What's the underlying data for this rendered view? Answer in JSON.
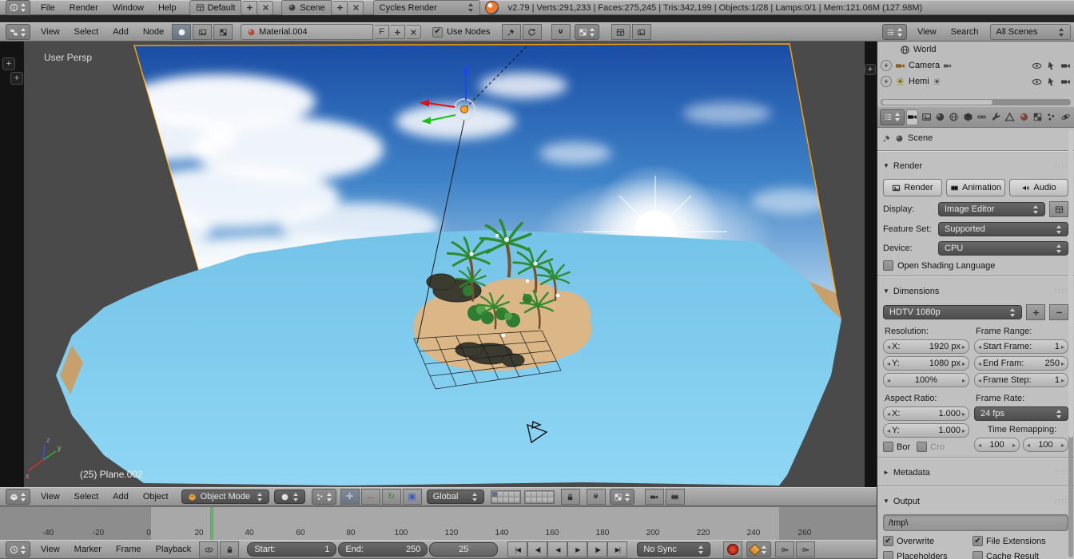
{
  "colors": {
    "selection_outline": "#ffa000",
    "cursor_green": "#55c155",
    "water": "#7cc9ec",
    "lamp_dot": "#ffa028",
    "record_red": "#b42010",
    "accent_sky": "#1a4da5"
  },
  "topbar": {
    "menus": [
      "File",
      "Render",
      "Window",
      "Help"
    ],
    "layout": "Default",
    "scene": "Scene",
    "engine": "Cycles Render",
    "stats": "v2.79 | Verts:291,233 | Faces:275,245 | Tris:342,199 | Objects:1/28 | Lamps:0/1 | Mem:121.06M (127.98M)"
  },
  "nodebar": {
    "menus": [
      "View",
      "Select",
      "Add",
      "Node"
    ],
    "material": "Material.004",
    "fake_user": "F",
    "use_nodes": "Use Nodes"
  },
  "outliner": {
    "menus": [
      "View",
      "Search"
    ],
    "filter": "All Scenes",
    "items": [
      "World",
      "Camera",
      "Hemi"
    ]
  },
  "viewport": {
    "view_label": "User Persp",
    "active_object": "(25) Plane.002",
    "axis": {
      "x": "x",
      "y": "y",
      "z": "z"
    }
  },
  "props": {
    "context": "Scene",
    "render": {
      "title": "Render",
      "buttons": {
        "render": "Render",
        "animation": "Animation",
        "audio": "Audio"
      },
      "display_label": "Display:",
      "display": "Image Editor",
      "feature_label": "Feature Set:",
      "feature": "Supported",
      "device_label": "Device:",
      "device": "CPU",
      "osl": "Open Shading Language"
    },
    "dim": {
      "title": "Dimensions",
      "preset": "HDTV 1080p",
      "resolution_label": "Resolution:",
      "frame_range_label": "Frame Range:",
      "res_x_label": "X:",
      "res_x": "1920 px",
      "res_y_label": "Y:",
      "res_y": "1080 px",
      "res_pct": "100%",
      "start_label": "Start Frame:",
      "start": "1",
      "end_label": "End Fram:",
      "end": "250",
      "step_label": "Frame Step:",
      "step": "1",
      "aspect_label": "Aspect Ratio:",
      "rate_label": "Frame Rate:",
      "asp_x_label": "X:",
      "asp_x": "1.000",
      "asp_y_label": "Y:",
      "asp_y": "1.000",
      "fps": "24 fps",
      "remap_label": "Time Remapping:",
      "remap_a": "100",
      "remap_b": "100",
      "border": "Bor",
      "crop": "Cro"
    },
    "metadata_title": "Metadata",
    "output": {
      "title": "Output",
      "path": "/tmp\\",
      "overwrite": "Overwrite",
      "file_ext": "File Extensions",
      "placeholders": "Placeholders",
      "cache": "Cache Result"
    }
  },
  "v3d": {
    "menus": [
      "View",
      "Select",
      "Add",
      "Object"
    ],
    "mode": "Object Mode",
    "orientation": "Global"
  },
  "timeline": {
    "ticks": [
      "-40",
      "-20",
      "0",
      "20",
      "40",
      "60",
      "80",
      "100",
      "120",
      "140",
      "160",
      "180",
      "200",
      "220",
      "240",
      "260"
    ],
    "menus": [
      "View",
      "Marker",
      "Frame",
      "Playback"
    ],
    "start_label": "Start:",
    "start": "1",
    "end_label": "End:",
    "end": "250",
    "frame": "25",
    "sync": "No Sync"
  }
}
